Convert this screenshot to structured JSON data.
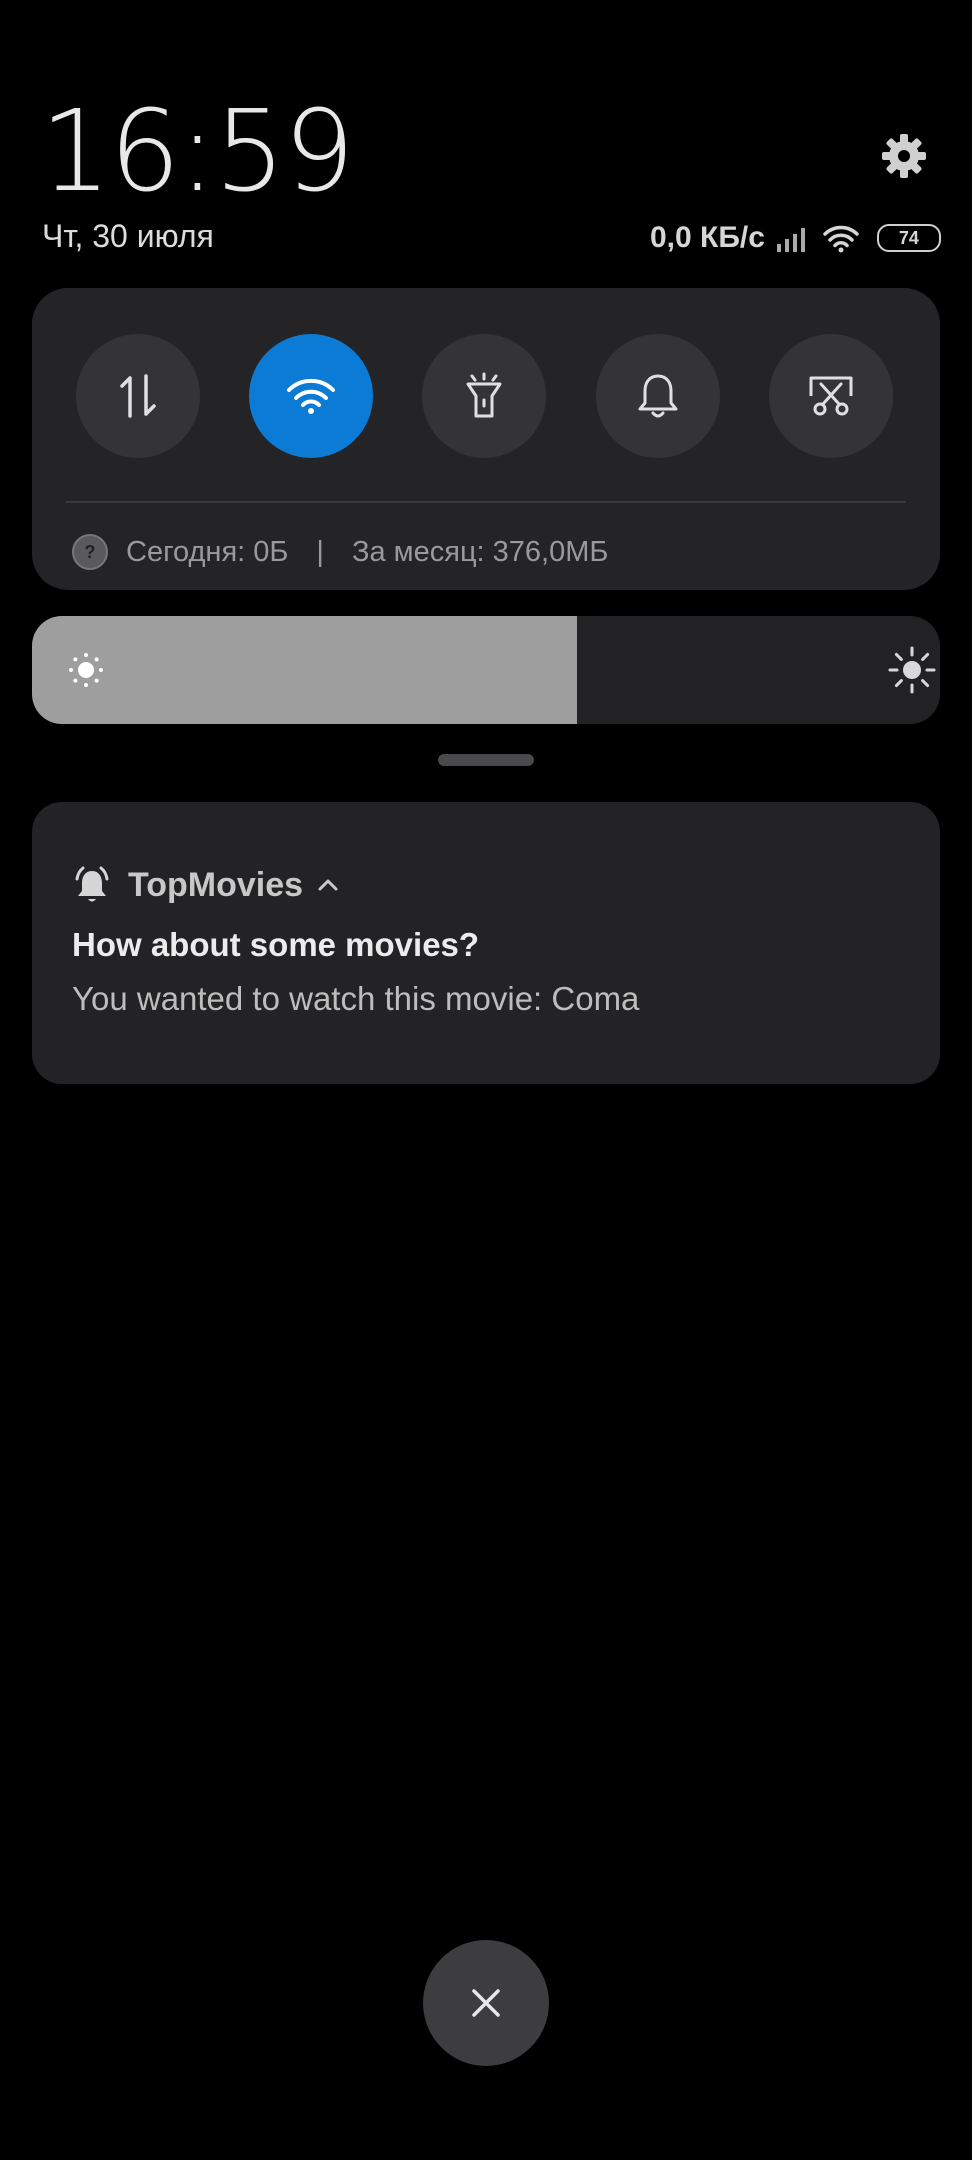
{
  "header": {
    "time": "16:59",
    "date": "Чт, 30 июля",
    "network_speed": "0,0 КБ/с",
    "battery_level": "74"
  },
  "quick_settings": {
    "toggles": [
      {
        "icon": "mobile-data-icon",
        "active": false
      },
      {
        "icon": "wifi-icon",
        "active": true
      },
      {
        "icon": "flashlight-icon",
        "active": false
      },
      {
        "icon": "bell-icon",
        "active": false
      },
      {
        "icon": "screenshot-icon",
        "active": false
      }
    ],
    "usage_today": "Сегодня: 0Б",
    "usage_separator": "|",
    "usage_month": "За месяц: 376,0МБ"
  },
  "brightness": {
    "level_fraction": 0.6
  },
  "notification": {
    "app_name": "TopMovies",
    "title": "How about some movies?",
    "body": "You wanted to watch this movie: Coma"
  },
  "colors": {
    "accent": "#0c7bd6",
    "panel": "#242426",
    "background": "#000000"
  }
}
